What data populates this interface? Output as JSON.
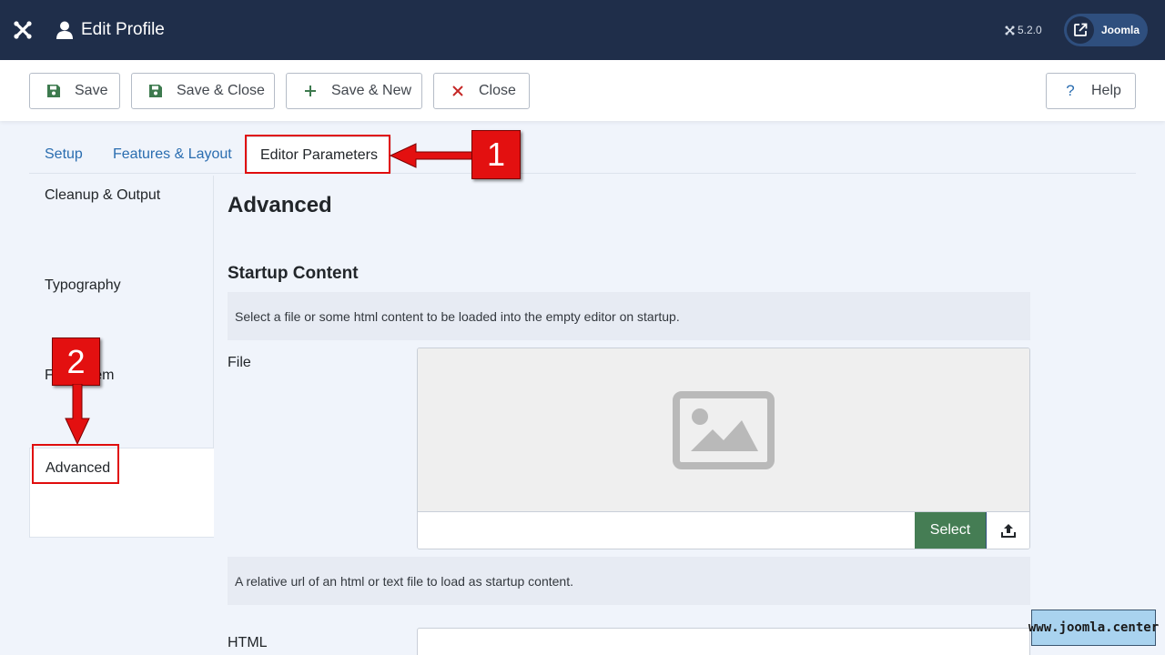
{
  "header": {
    "title": "Edit Profile",
    "version": "5.2.0",
    "site_button_label": "Joomla"
  },
  "toolbar": {
    "save": "Save",
    "save_close": "Save & Close",
    "save_new": "Save & New",
    "close": "Close",
    "help": "Help"
  },
  "tabs": [
    {
      "label": "Setup"
    },
    {
      "label": "Features & Layout"
    },
    {
      "label": "Editor Parameters",
      "active": true
    }
  ],
  "side_tabs": [
    {
      "label": "Cleanup & Output"
    },
    {
      "label": "Typography"
    },
    {
      "label": "Filesystem"
    },
    {
      "label": "Advanced",
      "active": true
    }
  ],
  "main": {
    "heading": "Advanced",
    "section_title": "Startup Content",
    "section_desc": "Select a file or some html content to be loaded into the empty editor on startup.",
    "file_label": "File",
    "file_value": "",
    "select_label": "Select",
    "file_desc": "A relative url of an html or text file to load as startup content.",
    "html_label": "HTML"
  },
  "annotations": {
    "badge_1": "1",
    "badge_2": "2"
  },
  "watermark": "www.joomla.center",
  "colors": {
    "header_bg": "#1f2e4a",
    "link_blue": "#2a6db0",
    "select_green": "#457d54",
    "annotation_red": "#e31010"
  }
}
